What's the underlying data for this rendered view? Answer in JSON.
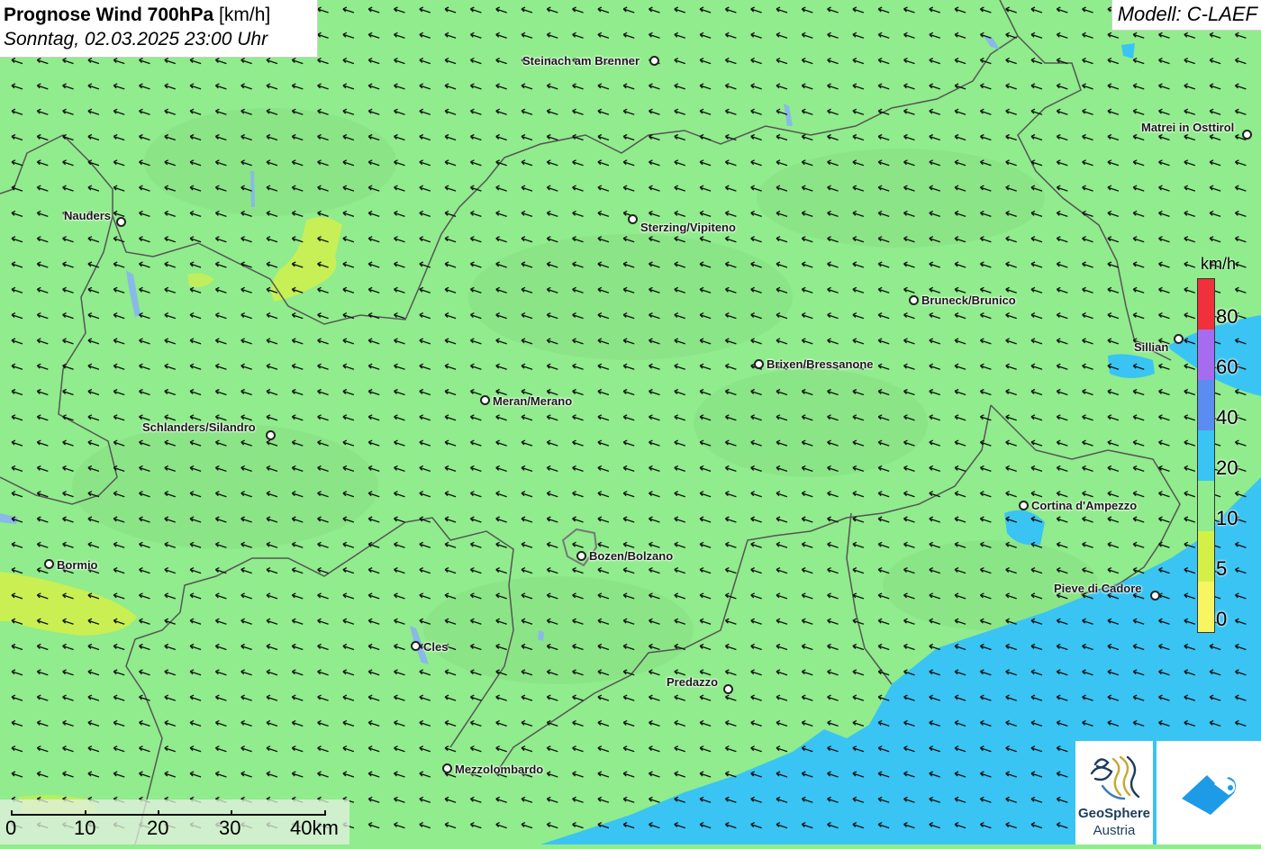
{
  "title": {
    "main": "Prognose Wind 700hPa",
    "unit": "[km/h]",
    "datetime": "Sonntag, 02.03.2025 23:00 Uhr"
  },
  "model": "Modell: C-LAEF",
  "cities": [
    {
      "name": "Steinach am Brenner"
    },
    {
      "name": "Matrei in Osttirol"
    },
    {
      "name": "Nauders"
    },
    {
      "name": "Sterzing/Vipiteno"
    },
    {
      "name": "Bruneck/Brunico"
    },
    {
      "name": "Sillian"
    },
    {
      "name": "Brixen/Bressanone"
    },
    {
      "name": "Meran/Merano"
    },
    {
      "name": "Schlanders/Silandro"
    },
    {
      "name": "Cortina d'Ampezzo"
    },
    {
      "name": "Bormio"
    },
    {
      "name": "Bozen/Bolzano"
    },
    {
      "name": "Pieve di Cadore"
    },
    {
      "name": "Cles"
    },
    {
      "name": "Predazzo"
    },
    {
      "name": "Mezzolombardo"
    }
  ],
  "legend": {
    "unit": "km/h",
    "labels": [
      "80",
      "60",
      "40",
      "20",
      "10",
      "5",
      "0"
    ],
    "colors": {
      "above_80": "#f0303a",
      "60_80": "#a66cf0",
      "40_60": "#5b8cf0",
      "20_40": "#39c4f4",
      "10_20": "#90ec8c",
      "5_10": "#d4f048",
      "0_5": "#f7f561"
    }
  },
  "scale": {
    "labels": [
      "0",
      "10",
      "20",
      "30",
      "40km"
    ]
  },
  "wind": {
    "direction": "from east-southeast",
    "dominant_band": "10-20 km/h",
    "arrow_icon": "wind-arrow-icon"
  },
  "logos": {
    "geosphere_line1": "GeoSphere",
    "geosphere_line2": "Austria"
  },
  "colors": {
    "background": "#90ec8c",
    "blue_zone": "#39c4f4",
    "yellow_zone": "#d4f048",
    "border": "#555555"
  }
}
